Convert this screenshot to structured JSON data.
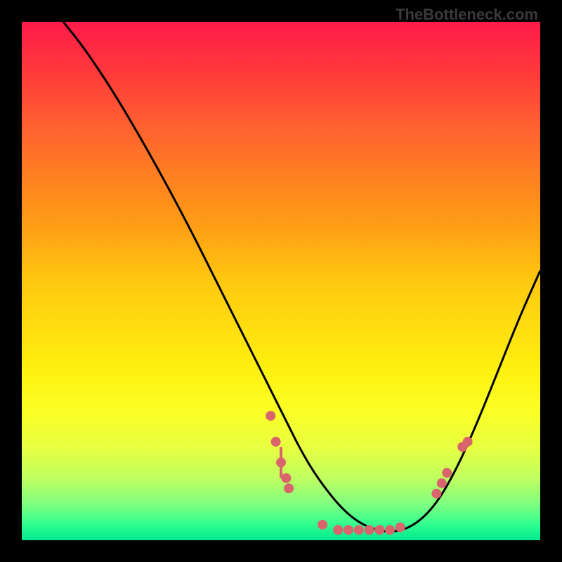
{
  "watermark": "TheBottleneck.com",
  "chart_data": {
    "type": "line",
    "title": "",
    "xlabel": "",
    "ylabel": "",
    "xlim": [
      0,
      100
    ],
    "ylim": [
      0,
      100
    ],
    "curve": {
      "name": "bottleneck-curve",
      "x": [
        8,
        12,
        18,
        25,
        32,
        38,
        44,
        50,
        55,
        60,
        64,
        68,
        72,
        76,
        80,
        84,
        88,
        92,
        96,
        100
      ],
      "y": [
        100,
        95,
        86,
        74,
        61,
        49,
        37,
        25,
        15,
        8,
        4,
        2,
        1.5,
        3,
        7,
        14,
        23,
        33,
        43,
        52
      ]
    },
    "scatter_points": {
      "name": "data-points",
      "color": "#d9646b",
      "points": [
        {
          "x": 48,
          "y": 24
        },
        {
          "x": 49,
          "y": 19
        },
        {
          "x": 50,
          "y": 15
        },
        {
          "x": 51,
          "y": 12
        },
        {
          "x": 51.5,
          "y": 10
        },
        {
          "x": 58,
          "y": 3
        },
        {
          "x": 61,
          "y": 2
        },
        {
          "x": 63,
          "y": 2
        },
        {
          "x": 65,
          "y": 2
        },
        {
          "x": 67,
          "y": 2
        },
        {
          "x": 69,
          "y": 2
        },
        {
          "x": 71,
          "y": 2
        },
        {
          "x": 73,
          "y": 2.5
        },
        {
          "x": 80,
          "y": 9
        },
        {
          "x": 81,
          "y": 11
        },
        {
          "x": 82,
          "y": 13
        },
        {
          "x": 85,
          "y": 18
        },
        {
          "x": 86,
          "y": 19
        }
      ]
    },
    "error_bars": {
      "name": "error-bars",
      "color": "#d9646b",
      "bars": [
        {
          "x": 50,
          "y_low": 12,
          "y_high": 18
        }
      ]
    },
    "background_gradient": {
      "top": "#ff1a4a",
      "bottom": "#00e890"
    }
  }
}
